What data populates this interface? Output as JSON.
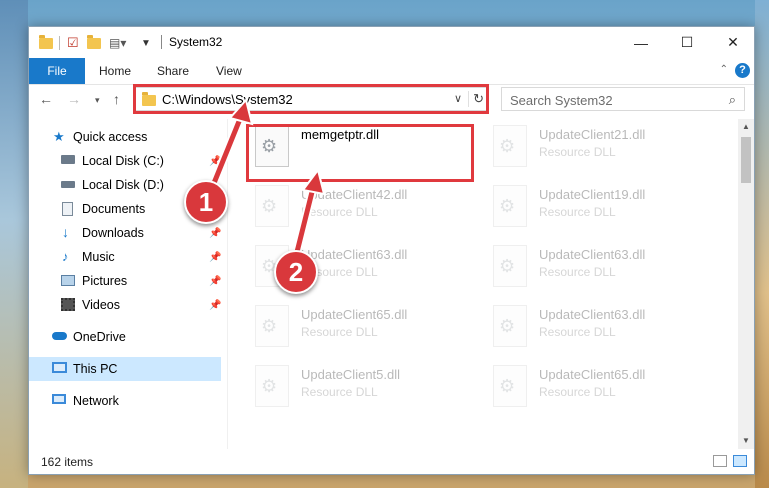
{
  "window": {
    "title": "System32",
    "controls": {
      "minimize": "—",
      "maximize": "☐",
      "close": "✕"
    }
  },
  "ribbon": {
    "tabs": [
      "File",
      "Home",
      "Share",
      "View"
    ],
    "help": "?"
  },
  "address": {
    "path": "C:\\Windows\\System32",
    "search_placeholder": "Search System32"
  },
  "sidebar": {
    "items": [
      {
        "label": "Quick access",
        "icon": "star-icon"
      },
      {
        "label": "Local Disk (C:)",
        "icon": "drive-icon",
        "pinned": true
      },
      {
        "label": "Local Disk (D:)",
        "icon": "drive-icon"
      },
      {
        "label": "Documents",
        "icon": "documents-icon",
        "pinned": true
      },
      {
        "label": "Downloads",
        "icon": "download-icon",
        "pinned": true
      },
      {
        "label": "Music",
        "icon": "music-icon",
        "pinned": true
      },
      {
        "label": "Pictures",
        "icon": "pictures-icon",
        "pinned": true
      },
      {
        "label": "Videos",
        "icon": "videos-icon",
        "pinned": true
      },
      {
        "label": "OneDrive",
        "icon": "cloud-icon"
      },
      {
        "label": "This PC",
        "icon": "computer-icon",
        "selected": true
      },
      {
        "label": "Network",
        "icon": "network-icon"
      }
    ]
  },
  "files": [
    {
      "name": "memgetptr.dll",
      "type": ""
    },
    {
      "name": "UpdateClient21.dll",
      "type": "Resource DLL"
    },
    {
      "name": "UpdateClient42.dll",
      "type": "Resource DLL"
    },
    {
      "name": "UpdateClient19.dll",
      "type": "Resource DLL"
    },
    {
      "name": "UpdateClient63.dll",
      "type": "Resource DLL"
    },
    {
      "name": "UpdateClient63.dll",
      "type": "Resource DLL"
    },
    {
      "name": "UpdateClient65.dll",
      "type": "Resource DLL"
    },
    {
      "name": "UpdateClient63.dll",
      "type": "Resource DLL"
    },
    {
      "name": "UpdateClient5.dll",
      "type": "Resource DLL"
    },
    {
      "name": "UpdateClient65.dll",
      "type": "Resource DLL"
    }
  ],
  "status": {
    "item_count": "162 items"
  },
  "callouts": {
    "one": "1",
    "two": "2"
  },
  "colors": {
    "accent": "#1979ca",
    "highlight": "#e0393e",
    "selected": "#cce8ff"
  }
}
